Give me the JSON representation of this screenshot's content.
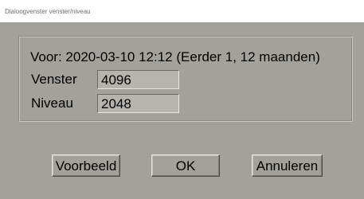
{
  "window": {
    "title": "Dialoogvenster venster/niveau"
  },
  "summary": {
    "text": "Voor: 2020-03-10 12:12 (Eerder 1, 12 maanden)"
  },
  "fields": {
    "venster": {
      "label": "Venster",
      "value": "4096"
    },
    "niveau": {
      "label": "Niveau",
      "value": "2048"
    }
  },
  "buttons": {
    "preview": "Voorbeeld",
    "ok": "OK",
    "cancel": "Annuleren"
  },
  "colors": {
    "dialog_background": "#a3a19c",
    "field_background": "#b6b4af",
    "titlebar_background": "#ffffff"
  }
}
